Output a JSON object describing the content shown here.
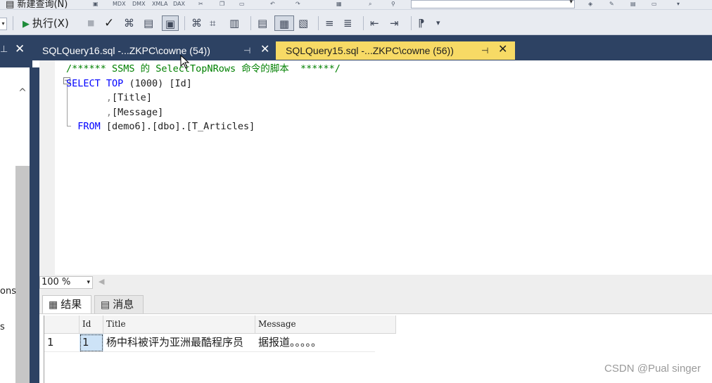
{
  "toolbar_top": {
    "new_query_label": "新建查询(N)"
  },
  "toolbar": {
    "execute_label": "执行(X)"
  },
  "left_panel": {
    "truncated_text_1": "ons",
    "truncated_text_2": "s"
  },
  "tabs": [
    {
      "title": "SQLQuery16.sql -...ZKPC\\cowne (54))",
      "active": false
    },
    {
      "title": "SQLQuery15.sql -...ZKPC\\cowne (56))",
      "active": true
    }
  ],
  "editor": {
    "lines": {
      "comment": "/****** SSMS 的 SelectTopNRows 命令的脚本  ******/",
      "select_kw": "SELECT",
      "top_kw": "TOP",
      "top_n": "(1000)",
      "col_id": "[Id]",
      "comma": ",",
      "col_title": "[Title]",
      "col_message": "[Message]",
      "from_kw": "FROM",
      "table_ref": "[demo6].[dbo].[T_Articles]"
    },
    "zoom": "100 %"
  },
  "results": {
    "tabs": [
      {
        "label": "结果",
        "icon": "grid-icon"
      },
      {
        "label": "消息",
        "icon": "messages-icon"
      }
    ],
    "columns": [
      "Id",
      "Title",
      "Message"
    ],
    "rows": [
      {
        "rownum": "1",
        "Id": "1",
        "Title": "杨中科被评为亚洲最酷程序员",
        "Message": "据报道。。。。。"
      }
    ]
  },
  "watermark": "CSDN @Pual singer",
  "colors": {
    "tab_strip": "#2d4263",
    "active_tab": "#f7da65",
    "keyword": "#0000ff",
    "comment": "#008000"
  }
}
